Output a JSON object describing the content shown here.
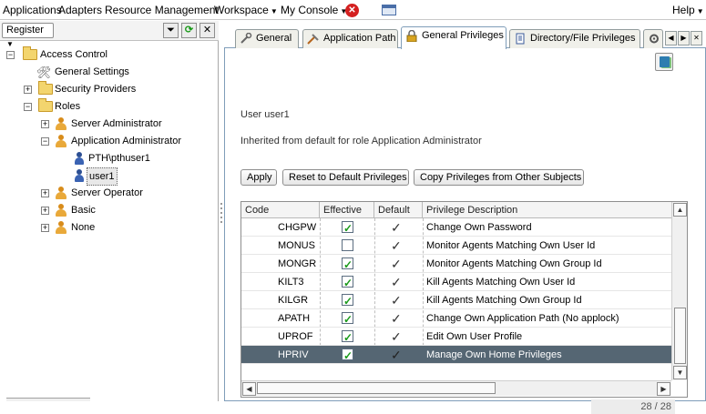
{
  "menubar": {
    "items": [
      "Applications",
      "Adapters",
      "Resource Management",
      "Workspace",
      "My Console"
    ],
    "help": "Help"
  },
  "left": {
    "register_label": "Register",
    "tree": [
      {
        "label": "Access Control",
        "icon": "folder-icon"
      },
      {
        "label": "General Settings",
        "icon": "tools-icon"
      },
      {
        "label": "Security Providers",
        "icon": "folder-icon"
      },
      {
        "label": "Roles",
        "icon": "folder-icon"
      },
      {
        "label": "Server Administrator",
        "icon": "role-icon"
      },
      {
        "label": "Application Administrator",
        "icon": "role-icon"
      },
      {
        "label": "PTH\\pthuser1",
        "icon": "user-icon"
      },
      {
        "label": "user1",
        "icon": "user-icon"
      },
      {
        "label": "Server Operator",
        "icon": "role-icon"
      },
      {
        "label": "Basic",
        "icon": "role-icon"
      },
      {
        "label": "None",
        "icon": "role-icon"
      }
    ]
  },
  "tabs": [
    "General",
    "Application Path",
    "General Privileges",
    "Directory/File Privileges"
  ],
  "active_tab": "General Privileges",
  "user_line": "User   user1",
  "inherited_line": "Inherited from default for role Application Administrator",
  "buttons": {
    "apply": "Apply",
    "reset": "Reset to Default Privileges",
    "copy": "Copy Privileges from Other Subjects"
  },
  "table": {
    "columns": [
      "Code",
      "Effective",
      "Default",
      "Privilege Description"
    ],
    "rows": [
      {
        "code": "CHGPW",
        "effective": true,
        "default": true,
        "description": "Change Own Password"
      },
      {
        "code": "MONUS",
        "effective": false,
        "default": true,
        "description": "Monitor Agents Matching Own User Id"
      },
      {
        "code": "MONGR",
        "effective": true,
        "default": true,
        "description": "Monitor Agents Matching Own Group Id"
      },
      {
        "code": "KILT3",
        "effective": true,
        "default": true,
        "description": "Kill Agents Matching Own User Id"
      },
      {
        "code": "KILGR",
        "effective": true,
        "default": true,
        "description": "Kill Agents Matching Own Group Id"
      },
      {
        "code": "APATH",
        "effective": true,
        "default": true,
        "description": "Change Own Application Path (No applock)"
      },
      {
        "code": "UPROF",
        "effective": true,
        "default": true,
        "description": "Edit Own User Profile"
      },
      {
        "code": "HPRIV",
        "effective": true,
        "default": true,
        "description": "Manage Own Home Privileges"
      }
    ],
    "selected_row": 7,
    "counter": "28 / 28"
  },
  "colors": {
    "selected_row": "#556673",
    "checkbox_green": "#1a9a1a",
    "close_red": "#d42020"
  }
}
